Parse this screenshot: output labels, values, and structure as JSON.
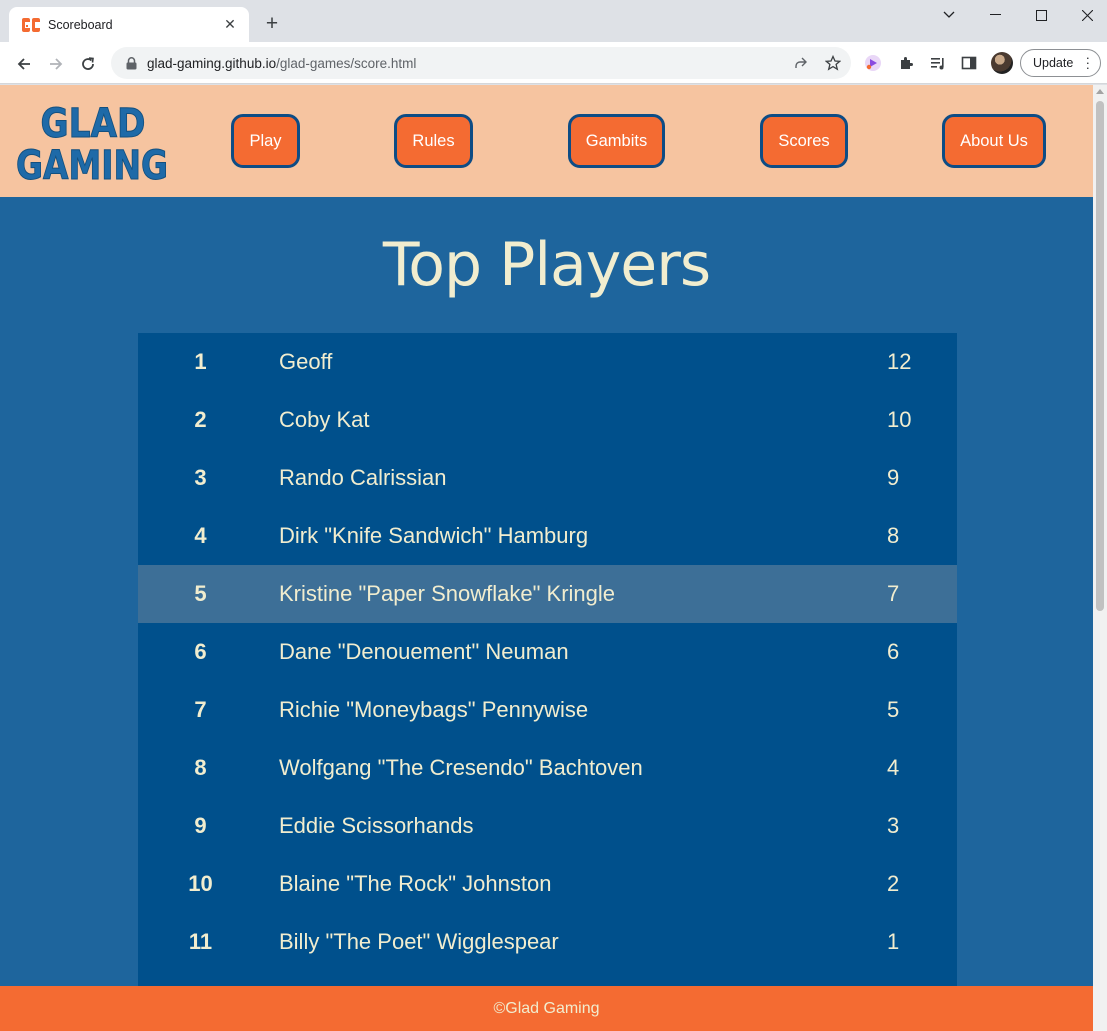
{
  "browser": {
    "tab_title": "Scoreboard",
    "url_host": "glad-gaming.github.io",
    "url_path": "/glad-games/score.html",
    "update_label": "Update"
  },
  "site": {
    "logo_line1": "GLAD",
    "logo_line2": "GAMING",
    "nav": [
      "Play",
      "Rules",
      "Gambits",
      "Scores",
      "About Us"
    ],
    "title": "Top Players",
    "footer": "©Glad Gaming",
    "colors": {
      "header_bg": "#f6c4a0",
      "page_bg": "#1e659d",
      "table_bg": "#00508c",
      "highlight_row": "#3d6f97",
      "accent_orange": "#f46b32",
      "border_blue": "#0d4c85",
      "text_cream": "#f1edcf"
    }
  },
  "players": [
    {
      "rank": "1",
      "name": "Geoff",
      "score": "12"
    },
    {
      "rank": "2",
      "name": "Coby Kat",
      "score": "10"
    },
    {
      "rank": "3",
      "name": "Rando Calrissian",
      "score": "9"
    },
    {
      "rank": "4",
      "name": "Dirk \"Knife Sandwich\" Hamburg",
      "score": "8"
    },
    {
      "rank": "5",
      "name": "Kristine \"Paper Snowflake\" Kringle",
      "score": "7"
    },
    {
      "rank": "6",
      "name": "Dane \"Denouement\" Neuman",
      "score": "6"
    },
    {
      "rank": "7",
      "name": "Richie \"Moneybags\" Pennywise",
      "score": "5"
    },
    {
      "rank": "8",
      "name": "Wolfgang \"The Cresendo\" Bachtoven",
      "score": "4"
    },
    {
      "rank": "9",
      "name": "Eddie Scissorhands",
      "score": "3"
    },
    {
      "rank": "10",
      "name": "Blaine \"The Rock\" Johnston",
      "score": "2"
    },
    {
      "rank": "11",
      "name": "Billy \"The Poet\" Wigglespear",
      "score": "1"
    }
  ]
}
